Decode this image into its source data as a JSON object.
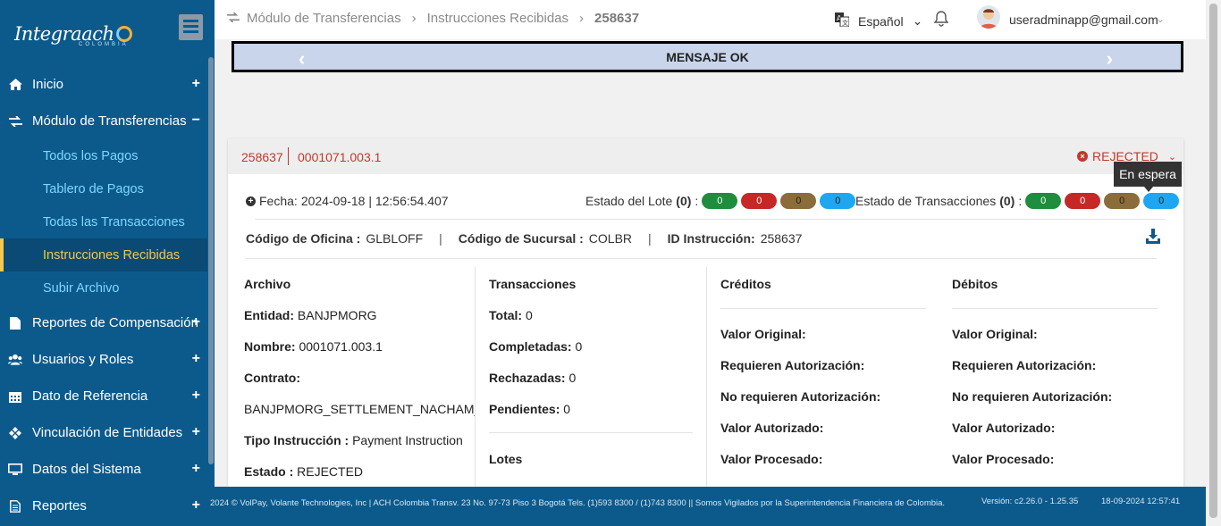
{
  "brand": {
    "name": "Integraach",
    "sub": "COLOMBIA"
  },
  "sidebar": {
    "items": [
      {
        "label": "Inicio",
        "icon": "home-icon",
        "toggle": "+"
      },
      {
        "label": "Módulo de Transferencias",
        "icon": "exchange-icon",
        "toggle": "−"
      },
      {
        "label": "Reportes de Compensación",
        "icon": "file-icon",
        "toggle": "+"
      },
      {
        "label": "Usuarios y Roles",
        "icon": "users-icon",
        "toggle": "+"
      },
      {
        "label": "Dato de Referencia",
        "icon": "calendar-icon",
        "toggle": "+"
      },
      {
        "label": "Vinculación de Entidades",
        "icon": "link-icon",
        "toggle": "+"
      },
      {
        "label": "Datos del Sistema",
        "icon": "monitor-icon",
        "toggle": "+"
      },
      {
        "label": "Reportes",
        "icon": "document-icon",
        "toggle": "+"
      }
    ],
    "subitems": [
      {
        "label": "Todos los Pagos"
      },
      {
        "label": "Tablero de Pagos"
      },
      {
        "label": "Todas las Transacciones"
      },
      {
        "label": "Instrucciones Recibidas",
        "active": true
      },
      {
        "label": "Subir Archivo"
      }
    ]
  },
  "header": {
    "breadcrumb": [
      "Módulo de Transferencias",
      "Instrucciones Recibidas",
      "258637"
    ],
    "language": "Español",
    "user_email": "useradminapp@gmail.com"
  },
  "banner": {
    "message": "MENSAJE OK"
  },
  "card": {
    "id": "258637",
    "ref": "0001071.003.1",
    "status": "REJECTED",
    "tooltip": "En espera",
    "fecha_label": "Fecha:",
    "fecha_value": "2024-09-18 | 12:56:54.407",
    "estado_lote_label": "Estado del Lote",
    "estado_lote_count": "(0)",
    "estado_lote_pills": [
      "0",
      "0",
      "0",
      "0"
    ],
    "estado_trans_label": "Estado de Transacciones",
    "estado_trans_count": "(0)",
    "estado_trans_pills": [
      "0",
      "0",
      "0",
      "0"
    ],
    "pill_colors": [
      "#1e8e3e",
      "#c62828",
      "#8a6d3b",
      "#1ea7f0"
    ],
    "codigo_oficina_label": "Código de Oficina :",
    "codigo_oficina": "GLBLOFF",
    "codigo_sucursal_label": "Código de Sucursal :",
    "codigo_sucursal": "COLBR",
    "id_instruccion_label": "ID Instrucción:",
    "id_instruccion": "258637",
    "archivo": {
      "title": "Archivo",
      "entidad_label": "Entidad:",
      "entidad": "BANJPMORG",
      "nombre_label": "Nombre:",
      "nombre": "0001071.003.1",
      "contrato_label": "Contrato:",
      "contrato": "BANJPMORG_SETTLEMENT_NACHAM_UI",
      "tipo_label": "Tipo Instrucción :",
      "tipo": "Payment Instruction",
      "estado_label": "Estado :",
      "estado": "REJECTED"
    },
    "transacciones": {
      "title": "Transacciones",
      "total_label": "Total:",
      "total": "0",
      "completadas_label": "Completadas:",
      "completadas": "0",
      "rechazadas_label": "Rechazadas:",
      "rechazadas": "0",
      "pendientes_label": "Pendientes:",
      "pendientes": "0",
      "lotes": "Lotes"
    },
    "creditos": {
      "title": "Créditos",
      "valor_original": "Valor Original:",
      "requieren": "Requieren Autorización:",
      "no_requieren": "No requieren Autorización:",
      "valor_autorizado": "Valor Autorizado:",
      "valor_procesado": "Valor Procesado:"
    },
    "debitos": {
      "title": "Débitos",
      "valor_original": "Valor Original:",
      "requieren": "Requieren Autorización:",
      "no_requieren": "No requieren Autorización:",
      "valor_autorizado": "Valor Autorizado:",
      "valor_procesado": "Valor Procesado:"
    }
  },
  "footer": {
    "text": "2024 © VolPay, Volante Technologies, Inc | ACH Colombia Transv. 23 No. 97-73 Piso 3 Bogotá Tels. (1)593 8300 / (1)743 8300 || Somos Vigilados por la Superintendencia Financiera de Colombia.",
    "version": "Versión: c2.26.0 - 1.25.35",
    "date": "18-09-2024 12:57:41"
  }
}
